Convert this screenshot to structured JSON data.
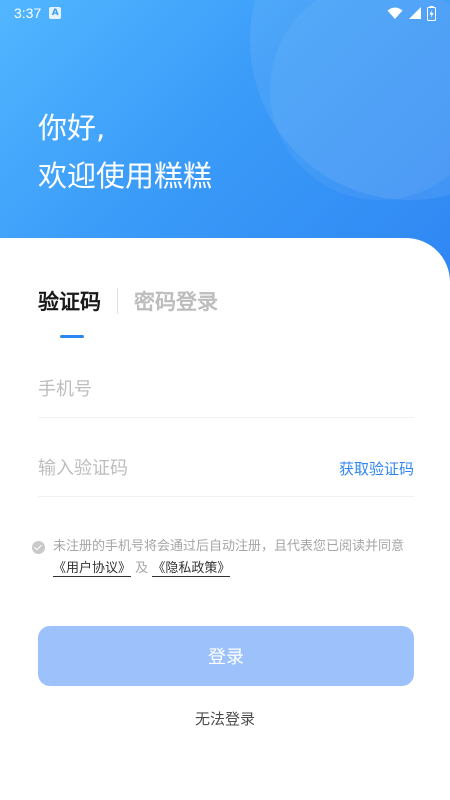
{
  "status_bar": {
    "time": "3:37",
    "notification_badge": "A",
    "icons": [
      "wifi-icon",
      "cellular-signal-icon",
      "battery-icon"
    ]
  },
  "header": {
    "greeting_line1": "你好,",
    "greeting_line2": "欢迎使用糕糕"
  },
  "tabs": {
    "active_label": "验证码",
    "inactive_label": "密码登录"
  },
  "form": {
    "phone_placeholder": "手机号",
    "phone_value": "",
    "code_placeholder": "输入验证码",
    "code_value": "",
    "get_code_label": "获取验证码"
  },
  "agreement": {
    "text_part1": "未注册的手机号将会通过后自动注册，且代表您已阅读并同意",
    "user_agreement_label": "《用户协议》",
    "connector": "及",
    "privacy_policy_label": "《隐私政策》"
  },
  "actions": {
    "login_label": "登录",
    "cannot_login_label": "无法登录"
  },
  "colors": {
    "accent": "#2f86f3",
    "login_button_disabled": "#9dc2fb",
    "hero_gradient_start": "#52b6ff",
    "hero_gradient_end": "#2f86f3"
  }
}
